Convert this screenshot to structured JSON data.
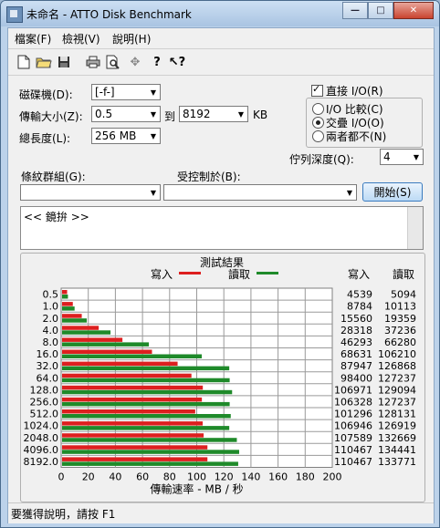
{
  "window": {
    "title": "未命名 - ATTO Disk Benchmark",
    "minimize": "—",
    "maximize": "□",
    "close": "✕"
  },
  "menu": [
    "檔案(F)",
    "檢視(V)",
    "說明(H)"
  ],
  "toolbar_icons": [
    "new-icon",
    "open-icon",
    "save-icon",
    "print-icon",
    "print-preview-icon",
    "move-icon",
    "help-icon",
    "context-help-icon"
  ],
  "form": {
    "drive_label": "磁碟機(D):",
    "drive_value": "[-f-]",
    "transfer_label": "傳輸大小(Z):",
    "transfer_from": "0.5",
    "to_label": "到",
    "transfer_to": "8192",
    "kb_label": "KB",
    "total_label": "總長度(L):",
    "total_value": "256 MB",
    "direct_io_label": "直接 I/O(R)",
    "io_compare_label": "I/O 比較(C)",
    "overlapped_io_label": "交疊 I/O(O)",
    "neither_label": "兩者都不(N)",
    "queue_label": "佇列深度(Q):",
    "queue_value": "4",
    "stripe_label": "條紋群組(G):",
    "stripe_value": "",
    "controlled_label": "受控制於(B):",
    "controlled_value": "",
    "start_button": "開始(S)",
    "description": "<< 鏡拚 >>"
  },
  "results": {
    "title": "測試結果",
    "write_legend": "寫入",
    "read_legend": "讀取",
    "write_col": "寫入",
    "read_col": "讀取",
    "xlabel": "傳輸速率 - MB / 秒"
  },
  "colors": {
    "write": "#dd1f1f",
    "read": "#1f8a2a"
  },
  "chart_data": {
    "type": "bar",
    "title": "測試結果",
    "xlabel": "傳輸速率 - MB / 秒",
    "xlim": [
      0,
      200
    ],
    "xticks": [
      "0",
      "20",
      "40",
      "60",
      "80",
      "100",
      "120",
      "140",
      "160",
      "180",
      "200"
    ],
    "categories": [
      "0.5",
      "1.0",
      "2.0",
      "4.0",
      "8.0",
      "16.0",
      "32.0",
      "64.0",
      "128.0",
      "256.0",
      "512.0",
      "1024.0",
      "2048.0",
      "4096.0",
      "8192.0"
    ],
    "series": [
      {
        "name": "寫入",
        "values": [
          4.4,
          8.6,
          15.2,
          27.7,
          45.2,
          67.0,
          85.9,
          96.1,
          104.5,
          103.8,
          98.9,
          104.4,
          105.1,
          107.9,
          107.9
        ]
      },
      {
        "name": "讀取",
        "values": [
          5.0,
          9.9,
          18.9,
          36.4,
          64.7,
          103.7,
          124.0,
          124.3,
          126.1,
          124.3,
          125.1,
          124.0,
          129.6,
          131.3,
          130.6
        ]
      }
    ],
    "write_table": [
      "4539",
      "8784",
      "15560",
      "28318",
      "46293",
      "68631",
      "87947",
      "98400",
      "106971",
      "106328",
      "101296",
      "106946",
      "107589",
      "110467",
      "110467"
    ],
    "read_table": [
      "5094",
      "10113",
      "19359",
      "37236",
      "66280",
      "106210",
      "126868",
      "127237",
      "129094",
      "127237",
      "128131",
      "126919",
      "132669",
      "134441",
      "133771"
    ]
  },
  "status": "要獲得說明，請按 F1"
}
